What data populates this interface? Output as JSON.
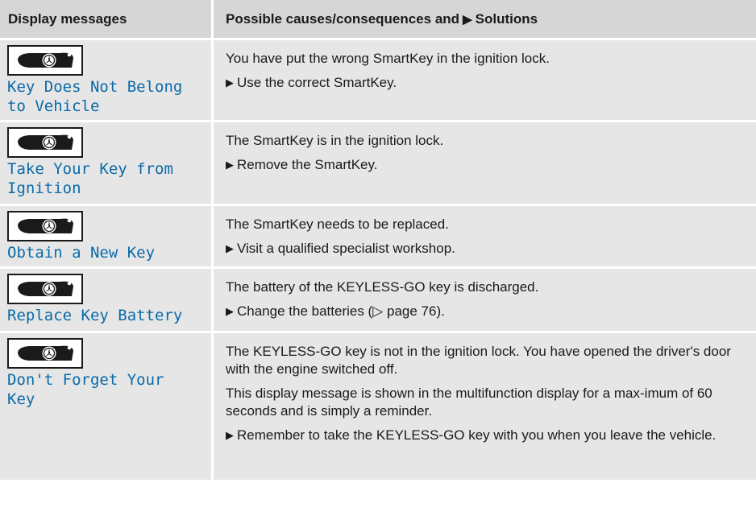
{
  "header": {
    "col1": "Display messages",
    "col2_prefix": "Possible causes/consequences and",
    "col2_suffix": "Solutions"
  },
  "icons": {
    "key": "smartkey-icon",
    "step": "triangle-right-icon"
  },
  "colors": {
    "message_text": "#0a6aa8",
    "header_bg": "#d6d6d6",
    "row_bg": "#e6e6e6"
  },
  "rows": [
    {
      "message": "Key Does Not Belong\nto Vehicle",
      "causes": [
        "You have put the wrong SmartKey in the ignition lock."
      ],
      "steps": [
        "Use the correct SmartKey."
      ]
    },
    {
      "message": "Take Your Key from\nIgnition",
      "causes": [
        "The SmartKey is in the ignition lock."
      ],
      "steps": [
        "Remove the SmartKey."
      ]
    },
    {
      "message": "Obtain a New Key",
      "causes": [
        "The SmartKey needs to be replaced."
      ],
      "steps": [
        "Visit a qualified specialist workshop."
      ]
    },
    {
      "message": "Replace Key Battery",
      "causes": [
        "The battery of the KEYLESS-GO key is discharged."
      ],
      "steps": [
        "Change the batteries (▷ page 76)."
      ]
    },
    {
      "message": "Don't Forget Your\nKey",
      "causes": [
        "The KEYLESS-GO key is not in the ignition lock. You have opened the driver's door with the engine switched off.",
        "This display message is shown in the multifunction display for a max-imum of 60 seconds and is simply a reminder."
      ],
      "steps": [
        "Remember to take the KEYLESS-GO key with you when you leave the vehicle."
      ]
    }
  ]
}
